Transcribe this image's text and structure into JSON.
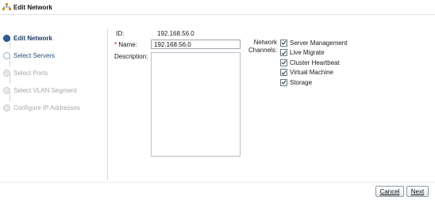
{
  "window": {
    "title": "Edit Network",
    "icon": "network-icon"
  },
  "steps": [
    {
      "label": "Edit Network",
      "state": "current"
    },
    {
      "label": "Select Servers",
      "state": "next"
    },
    {
      "label": "Select Ports",
      "state": "disabled"
    },
    {
      "label": "Select VLAN Segment",
      "state": "disabled"
    },
    {
      "label": "Configure IP Addresses",
      "state": "disabled"
    }
  ],
  "form": {
    "id_label": "ID:",
    "id_value": "192.168.56.0",
    "name_label": "Name:",
    "name_required_marker": "*",
    "name_value": "192.168.56.0",
    "description_label": "Description:",
    "description_value": "",
    "channels_label_line1": "Network",
    "channels_label_line2": "Channels:",
    "channels": [
      {
        "label": "Server Management",
        "checked": true
      },
      {
        "label": "Live Migrate",
        "checked": true
      },
      {
        "label": "Cluster Heartbeat",
        "checked": true
      },
      {
        "label": "Virtual Machine",
        "checked": true
      },
      {
        "label": "Storage",
        "checked": true
      }
    ]
  },
  "buttons": {
    "cancel": "Cancel",
    "next": "Next"
  },
  "colors": {
    "accent": "#2f5f94",
    "disabled": "#a7a7a7",
    "required": "#cc0000"
  }
}
